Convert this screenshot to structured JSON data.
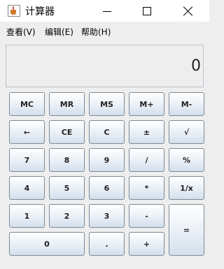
{
  "window": {
    "title": "计算器",
    "app_icon": "java-icon"
  },
  "menu": [
    {
      "label": "查看(V)"
    },
    {
      "label": "编辑(E)"
    },
    {
      "label": "帮助(H)"
    }
  ],
  "display": {
    "value": "0"
  },
  "buttons": {
    "mc": "MC",
    "mr": "MR",
    "ms": "MS",
    "mplus": "M+",
    "mminus": "M-",
    "backspace": "←",
    "ce": "CE",
    "c": "C",
    "plusminus": "±",
    "sqrt": "√",
    "seven": "7",
    "eight": "8",
    "nine": "9",
    "divide": "/",
    "percent": "%",
    "four": "4",
    "five": "5",
    "six": "6",
    "multiply": "*",
    "reciprocal": "1/x",
    "one": "1",
    "two": "2",
    "three": "3",
    "minus": "-",
    "equals": "=",
    "zero": "0",
    "dot": ".",
    "plus": "+"
  }
}
